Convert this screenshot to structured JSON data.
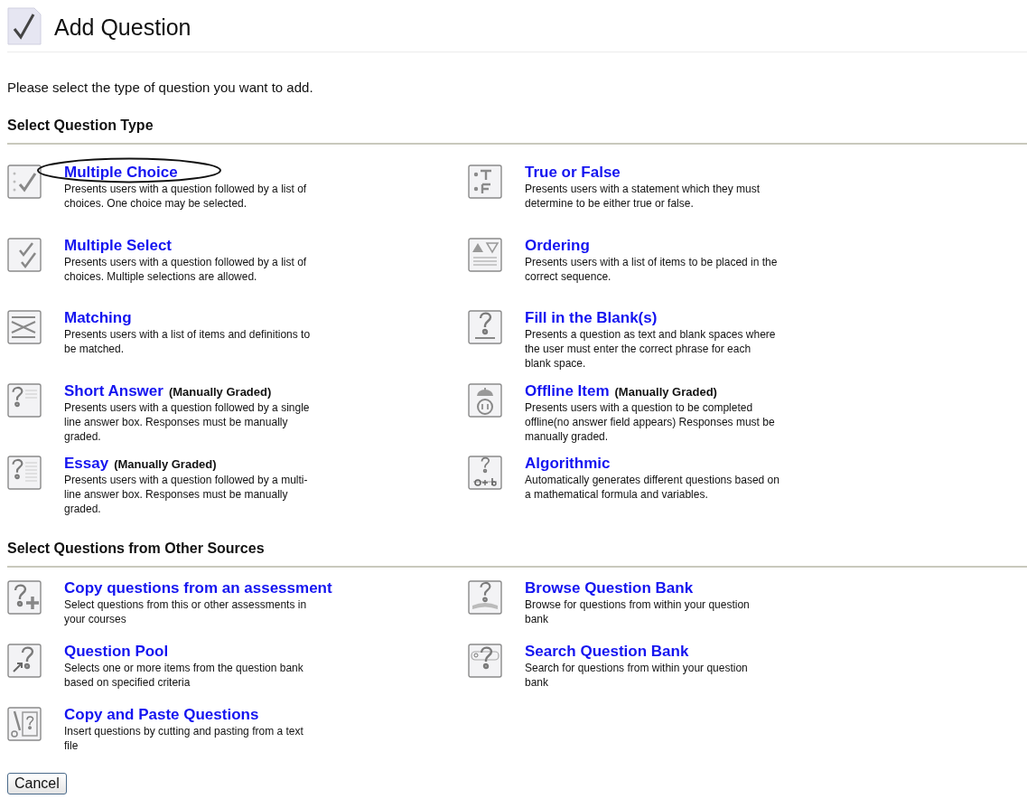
{
  "header": {
    "title": "Add Question"
  },
  "intro": "Please select the type of question you want to add.",
  "sections": [
    {
      "heading": "Select Question Type",
      "items": [
        {
          "kind": "multiple-choice",
          "title": "Multiple Choice",
          "circled": true,
          "description": "Presents users with a question followed by a list of choices. One choice may be selected."
        },
        {
          "kind": "true-false",
          "title": "True or False",
          "circled": false,
          "description": "Presents users with a statement which they must determine to be either true or false."
        },
        {
          "kind": "multiple-select",
          "title": "Multiple Select",
          "circled": false,
          "description": "Presents users with a question followed by a list of choices. Multiple selections are allowed."
        },
        {
          "kind": "ordering",
          "title": "Ordering",
          "circled": false,
          "description": "Presents users with a list of items to be placed in the correct sequence."
        },
        {
          "kind": "matching",
          "title": "Matching",
          "circled": false,
          "description": "Presents users with a list of items and definitions to be matched."
        },
        {
          "kind": "fill-blank",
          "title": "Fill in the Blank(s)",
          "circled": false,
          "description": "Presents a question as text and blank spaces where the user must enter the correct phrase for each blank space."
        },
        {
          "kind": "short-answer",
          "title": "Short Answer",
          "note": "(Manually Graded)",
          "circled": false,
          "description": "Presents users with a question followed by a single line answer box. Responses must be manually graded."
        },
        {
          "kind": "offline",
          "title": "Offline Item",
          "note": "(Manually Graded)",
          "circled": false,
          "description": "Presents users with a question to be completed offline(no answer field appears) Responses must be manually graded."
        },
        {
          "kind": "essay",
          "title": "Essay",
          "note": "(Manually Graded)",
          "circled": false,
          "description": "Presents users with a question followed by a multi-line answer box. Responses must be manually graded."
        },
        {
          "kind": "algorithmic",
          "title": "Algorithmic",
          "circled": false,
          "description": "Automatically generates different questions based on a mathematical formula and variables."
        }
      ]
    },
    {
      "heading": "Select Questions from Other Sources",
      "items": [
        {
          "kind": "copy-assessment",
          "title": "Copy questions from an assessment",
          "circled": false,
          "description": "Select questions from this or other assessments in your courses"
        },
        {
          "kind": "browse-bank",
          "title": "Browse Question Bank",
          "circled": false,
          "description": "Browse for questions from within your question bank"
        },
        {
          "kind": "pool",
          "title": "Question Pool",
          "circled": false,
          "description": "Selects one or more items from the question bank based on specified criteria"
        },
        {
          "kind": "search-bank",
          "title": "Search Question Bank",
          "circled": false,
          "description": "Search for questions from within your question bank"
        },
        {
          "kind": "paste",
          "title": "Copy and Paste Questions",
          "circled": false,
          "description": "Insert questions by cutting and pasting from a text file"
        }
      ]
    }
  ],
  "buttons": [
    "Cancel"
  ]
}
